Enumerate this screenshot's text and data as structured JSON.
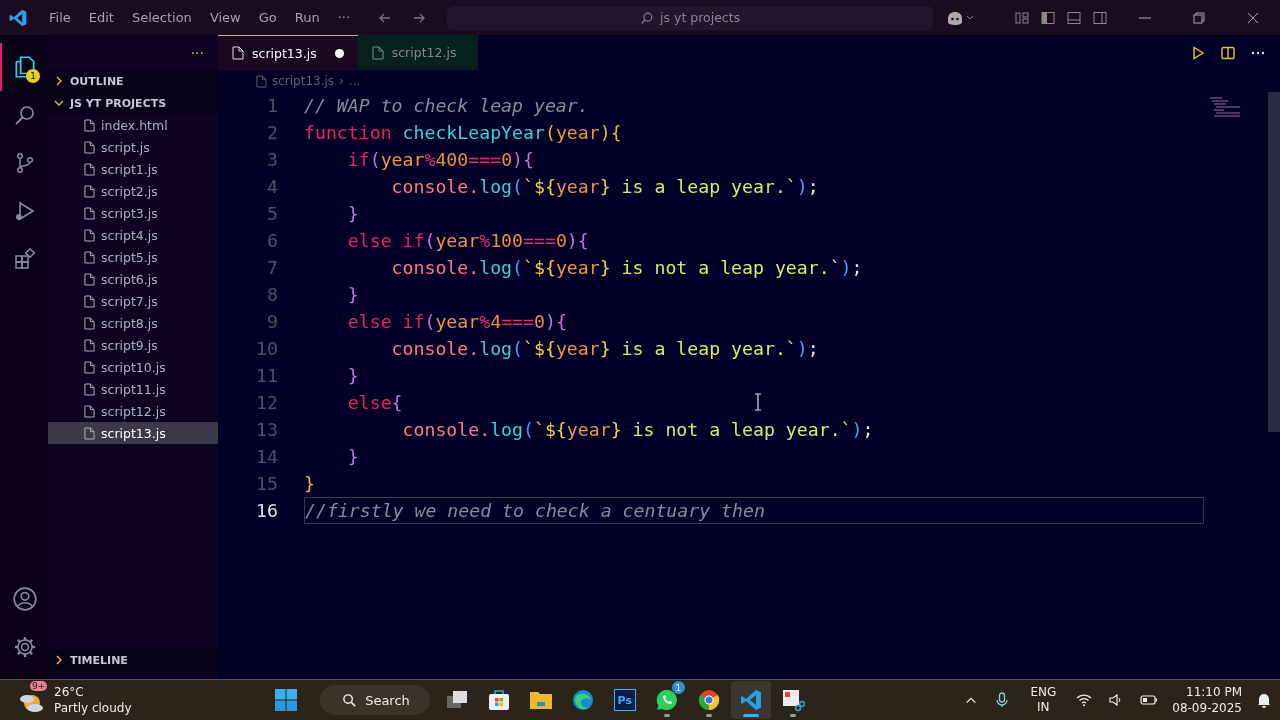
{
  "title_bar": {
    "menus": [
      "File",
      "Edit",
      "Selection",
      "View",
      "Go",
      "Run",
      "···"
    ],
    "search": {
      "value": "js yt projects"
    }
  },
  "activity_bar": [
    {
      "kind": "explorer",
      "selected": true,
      "badge": "1"
    },
    {
      "kind": "search",
      "selected": false
    },
    {
      "kind": "source-control",
      "selected": false
    },
    {
      "kind": "run",
      "selected": false
    },
    {
      "kind": "extensions",
      "selected": false
    },
    {
      "kind": "account",
      "selected": false
    },
    {
      "kind": "settings",
      "selected": false
    }
  ],
  "sidebar": {
    "more": "···",
    "sections": [
      {
        "label": "OUTLINE",
        "expanded": false
      },
      {
        "label": "JS YT PROJECTS",
        "expanded": true
      }
    ],
    "files": [
      {
        "name": "index.html",
        "selected": false
      },
      {
        "name": "script.js",
        "selected": false
      },
      {
        "name": "script1.js",
        "selected": false
      },
      {
        "name": "script2.js",
        "selected": false
      },
      {
        "name": "script3.js",
        "selected": false
      },
      {
        "name": "script4.js",
        "selected": false
      },
      {
        "name": "script5.js",
        "selected": false
      },
      {
        "name": "script6.js",
        "selected": false
      },
      {
        "name": "script7.js",
        "selected": false
      },
      {
        "name": "script8.js",
        "selected": false
      },
      {
        "name": "script9.js",
        "selected": false
      },
      {
        "name": "script10.js",
        "selected": false
      },
      {
        "name": "script11.js",
        "selected": false
      },
      {
        "name": "script12.js",
        "selected": false
      },
      {
        "name": "script13.js",
        "selected": true
      }
    ],
    "timeline": {
      "label": "TIMELINE",
      "expanded": false
    }
  },
  "tabs": [
    {
      "label": "script13.js",
      "selected": true,
      "modified": true
    },
    {
      "label": "script12.js",
      "selected": false,
      "modified": false
    }
  ],
  "breadcrumb": [
    "script13.js",
    "›",
    "..."
  ],
  "editor": {
    "lines": [
      {
        "number": "1",
        "current": false,
        "tokens": [
          {
            "t": "// WAP to check leap year.",
            "color": "#8a8a9a"
          }
        ]
      },
      {
        "number": "2",
        "current": false,
        "tokens": [
          {
            "t": "function ",
            "color": "#e8245a"
          },
          {
            "t": "checkLeapYear",
            "color": "#3fd0d8"
          },
          {
            "t": "(",
            "color": "#f2b43a"
          },
          {
            "t": "year",
            "color": "#f0924a"
          },
          {
            "t": "){",
            "color": "#f2b43a"
          }
        ]
      },
      {
        "number": "3",
        "current": false,
        "tokens": [
          {
            "t": "    if",
            "color": "#e8245a"
          },
          {
            "t": "(",
            "color": "#c872e0"
          },
          {
            "t": "year",
            "color": "#f0924a"
          },
          {
            "t": "%",
            "color": "#e0306a"
          },
          {
            "t": "400",
            "color": "#f08a40"
          },
          {
            "t": "===",
            "color": "#e0306a"
          },
          {
            "t": "0",
            "color": "#f08a40"
          },
          {
            "t": "){",
            "color": "#c872e0"
          }
        ]
      },
      {
        "number": "4",
        "current": false,
        "tokens": [
          {
            "t": "        console.",
            "color": "#ff7a8a"
          },
          {
            "t": "log",
            "color": "#3fd0d8"
          },
          {
            "t": "(",
            "color": "#4a9cff"
          },
          {
            "t": "`${",
            "color": "#f5d23a"
          },
          {
            "t": "year",
            "color": "#f0924a"
          },
          {
            "t": "}",
            "color": "#f5d23a"
          },
          {
            "t": " is a leap year.`",
            "color": "#dfe86a"
          },
          {
            "t": ")",
            "color": "#4a9cff"
          },
          {
            "t": ";",
            "color": "#e8e8e8"
          }
        ]
      },
      {
        "number": "5",
        "current": false,
        "tokens": [
          {
            "t": "    }",
            "color": "#c872e0"
          }
        ]
      },
      {
        "number": "6",
        "current": false,
        "tokens": [
          {
            "t": "    else if",
            "color": "#e8245a"
          },
          {
            "t": "(",
            "color": "#c872e0"
          },
          {
            "t": "year",
            "color": "#f0924a"
          },
          {
            "t": "%",
            "color": "#e0306a"
          },
          {
            "t": "100",
            "color": "#f08a40"
          },
          {
            "t": "===",
            "color": "#e0306a"
          },
          {
            "t": "0",
            "color": "#f08a40"
          },
          {
            "t": "){",
            "color": "#c872e0"
          }
        ]
      },
      {
        "number": "7",
        "current": false,
        "tokens": [
          {
            "t": "        console.",
            "color": "#ff7a8a"
          },
          {
            "t": "log",
            "color": "#3fd0d8"
          },
          {
            "t": "(",
            "color": "#4a9cff"
          },
          {
            "t": "`${",
            "color": "#f5d23a"
          },
          {
            "t": "year",
            "color": "#f0924a"
          },
          {
            "t": "}",
            "color": "#f5d23a"
          },
          {
            "t": " is not a leap year.`",
            "color": "#dfe86a"
          },
          {
            "t": ")",
            "color": "#4a9cff"
          },
          {
            "t": ";",
            "color": "#e8e8e8"
          }
        ]
      },
      {
        "number": "8",
        "current": false,
        "tokens": [
          {
            "t": "    }",
            "color": "#c872e0"
          }
        ]
      },
      {
        "number": "9",
        "current": false,
        "tokens": [
          {
            "t": "    else if",
            "color": "#e8245a"
          },
          {
            "t": "(",
            "color": "#c872e0"
          },
          {
            "t": "year",
            "color": "#f0924a"
          },
          {
            "t": "%",
            "color": "#e0306a"
          },
          {
            "t": "4",
            "color": "#f08a40"
          },
          {
            "t": "===",
            "color": "#e0306a"
          },
          {
            "t": "0",
            "color": "#f08a40"
          },
          {
            "t": "){",
            "color": "#c872e0"
          }
        ]
      },
      {
        "number": "10",
        "current": false,
        "tokens": [
          {
            "t": "        console.",
            "color": "#ff7a8a"
          },
          {
            "t": "log",
            "color": "#3fd0d8"
          },
          {
            "t": "(",
            "color": "#4a9cff"
          },
          {
            "t": "`${",
            "color": "#f5d23a"
          },
          {
            "t": "year",
            "color": "#f0924a"
          },
          {
            "t": "}",
            "color": "#f5d23a"
          },
          {
            "t": " is a leap year.`",
            "color": "#dfe86a"
          },
          {
            "t": ")",
            "color": "#4a9cff"
          },
          {
            "t": ";",
            "color": "#e8e8e8"
          }
        ]
      },
      {
        "number": "11",
        "current": false,
        "tokens": [
          {
            "t": "    }",
            "color": "#c872e0"
          }
        ]
      },
      {
        "number": "12",
        "current": false,
        "tokens": [
          {
            "t": "    else",
            "color": "#e8245a"
          },
          {
            "t": "{",
            "color": "#c872e0"
          }
        ]
      },
      {
        "number": "13",
        "current": false,
        "tokens": [
          {
            "t": "         console.",
            "color": "#ff7a8a"
          },
          {
            "t": "log",
            "color": "#3fd0d8"
          },
          {
            "t": "(",
            "color": "#4a9cff"
          },
          {
            "t": "`${",
            "color": "#f5d23a"
          },
          {
            "t": "year",
            "color": "#f0924a"
          },
          {
            "t": "}",
            "color": "#f5d23a"
          },
          {
            "t": " is not a leap year.`",
            "color": "#dfe86a"
          },
          {
            "t": ")",
            "color": "#4a9cff"
          },
          {
            "t": ";",
            "color": "#e8e8e8"
          }
        ]
      },
      {
        "number": "14",
        "current": false,
        "tokens": [
          {
            "t": "    }",
            "color": "#c872e0"
          }
        ]
      },
      {
        "number": "15",
        "current": false,
        "tokens": [
          {
            "t": "}",
            "color": "#f2b43a"
          }
        ]
      },
      {
        "number": "16",
        "current": true,
        "tokens": [
          {
            "t": "//firstly we need to check a centuary then",
            "color": "#8a8a9a"
          }
        ]
      }
    ]
  },
  "taskbar": {
    "weather": {
      "badge": "9+",
      "temperature": "26°C",
      "condition": "Partly cloudy"
    },
    "search": "Search",
    "apps": [
      {
        "kind": "task-view",
        "running": false,
        "active": false
      },
      {
        "kind": "store",
        "running": false,
        "active": false
      },
      {
        "kind": "folder",
        "running": false,
        "active": false
      },
      {
        "kind": "edge",
        "running": false,
        "active": false
      },
      {
        "kind": "photoshop",
        "running": false,
        "active": false,
        "label": "Ps"
      },
      {
        "kind": "chat",
        "running": true,
        "active": false,
        "badge": "1"
      },
      {
        "kind": "browser",
        "running": true,
        "active": false
      },
      {
        "kind": "code",
        "running": true,
        "active": true
      },
      {
        "kind": "snipping",
        "running": true,
        "active": false
      }
    ],
    "language": [
      "ENG",
      "IN"
    ],
    "time": "11:10 PM",
    "date": "08-09-2025"
  }
}
